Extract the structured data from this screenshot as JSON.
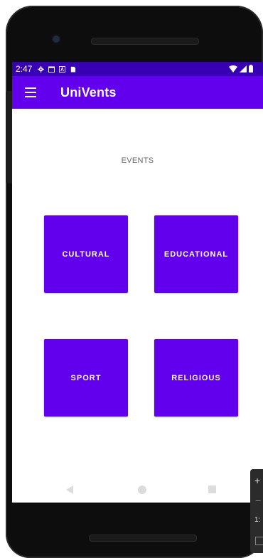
{
  "status_bar": {
    "time": "2:47",
    "icons": [
      "settings-icon",
      "calendar-icon",
      "a-icon",
      "sd-card-icon"
    ],
    "right_icons": [
      "wifi-icon",
      "signal-icon",
      "battery-icon"
    ]
  },
  "app_bar": {
    "title": "UniVents",
    "menu_icon": "hamburger-menu-icon"
  },
  "content": {
    "section_label": "EVENTS",
    "categories": [
      {
        "label": "CULTURAL"
      },
      {
        "label": "EDUCATIONAL"
      },
      {
        "label": "SPORT"
      },
      {
        "label": "RELIGIOUS"
      }
    ]
  },
  "nav_bar": {
    "icons": [
      "back-icon",
      "home-icon",
      "recents-icon"
    ]
  },
  "emulator_panel": {
    "zoom_in": "+",
    "zoom_out": "−",
    "ratio": "1:"
  },
  "colors": {
    "status_bar": "#3700b3",
    "primary": "#6200ee",
    "text_on_primary": "#ffffff",
    "label_text": "#666666"
  }
}
